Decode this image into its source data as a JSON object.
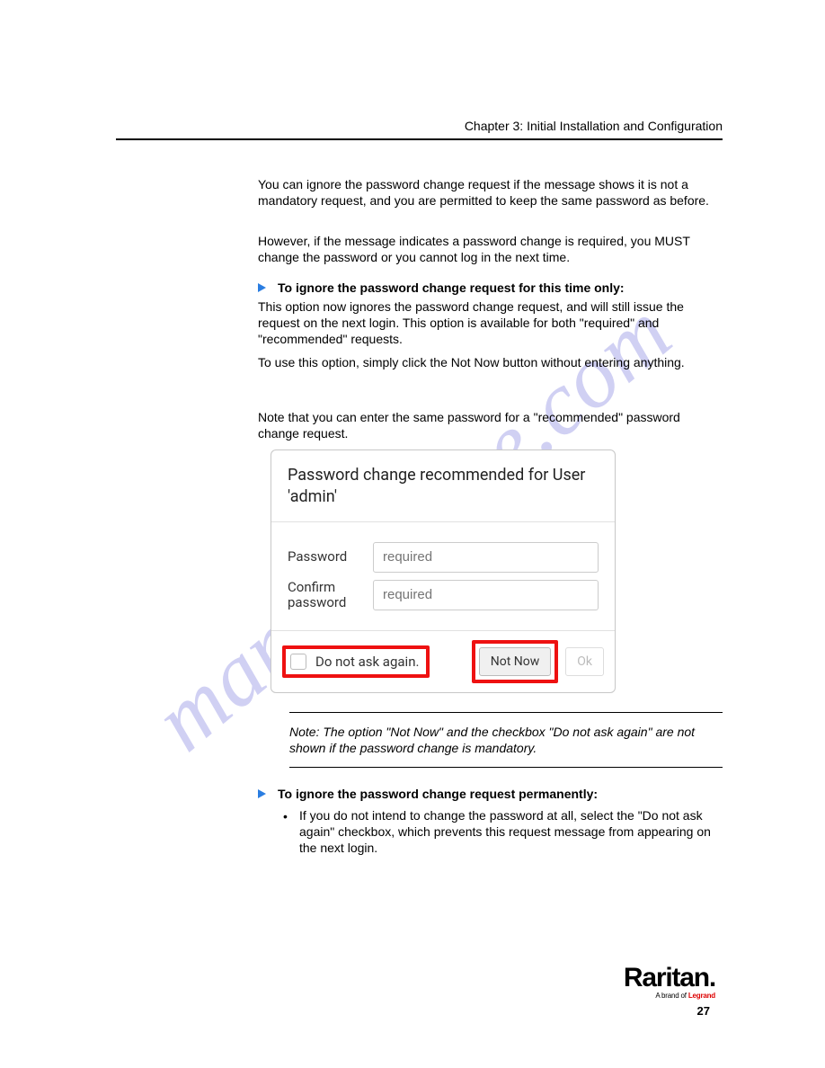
{
  "chapter_header": "Chapter 3: Initial Installation and Configuration",
  "watermark": "manualshive.com",
  "para1": "You can ignore the password change request if the message shows it is not a mandatory request, and you are permitted to keep the same password as before.",
  "para2": "However, if the message indicates a password change is required, you MUST change the password or you cannot log in the next time.",
  "sub1": "To ignore the password change request for this time only:",
  "para3": "This option now ignores the password change request, and will still issue the request on the next login. This option is available for both \"required\" and \"recommended\" requests.",
  "para4": "To use this option, simply click the Not Now button without entering anything.",
  "para5": "Note that you can enter the same password for a \"recommended\" password change request.",
  "dialog": {
    "title": "Password change recommended for User 'admin'",
    "password_label": "Password",
    "password_placeholder": "required",
    "confirm_label": "Confirm password",
    "confirm_placeholder": "required",
    "checkbox_label": "Do not ask again.",
    "not_now": "Not Now",
    "ok": "Ok"
  },
  "note": "Note: The option \"Not Now\" and the checkbox \"Do not ask again\" are not shown if the password change is mandatory.",
  "sub2": "To ignore the password change request permanently:",
  "para6": "If you do not intend to change the password at all, select the \"Do not ask again\" checkbox, which prevents this request message from appearing on the next login.",
  "logo_brand": "Raritan.",
  "logo_sub_prefix": "A brand of ",
  "logo_sub_red": "Legrand",
  "page_number": "27"
}
